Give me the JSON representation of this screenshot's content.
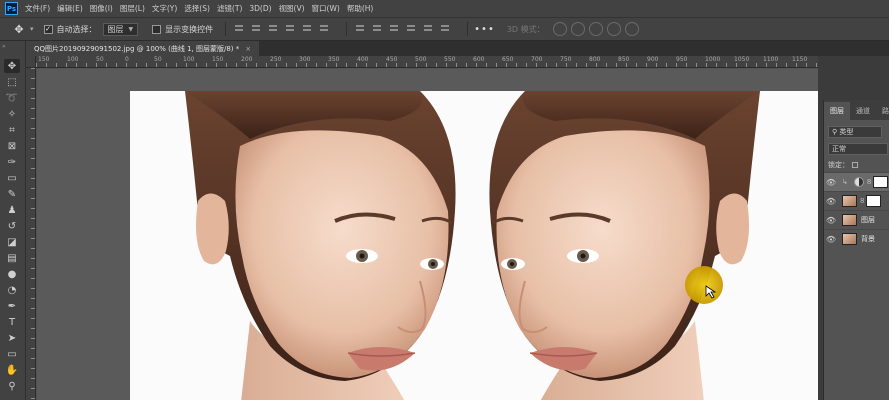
{
  "app": {
    "logo": "Ps"
  },
  "menu": [
    "文件(F)",
    "编辑(E)",
    "图像(I)",
    "图层(L)",
    "文字(Y)",
    "选择(S)",
    "滤镜(T)",
    "3D(D)",
    "视图(V)",
    "窗口(W)",
    "帮助(H)"
  ],
  "options": {
    "auto_select_label": "自动选择：",
    "auto_select_value": "图层",
    "show_transform_label": "显示变换控件",
    "more": "•••",
    "mode_3d": "3D 模式："
  },
  "document": {
    "tab_title": "QQ图片20190929091502.jpg @ 100% (曲线 1, 图层蒙版/8) *",
    "close": "×"
  },
  "ruler": {
    "top_labels": [
      "150",
      "100",
      "50",
      "0",
      "50",
      "100",
      "150",
      "200",
      "250",
      "300",
      "350",
      "400",
      "450",
      "500",
      "550",
      "600",
      "650",
      "700",
      "750",
      "800",
      "850",
      "900",
      "950",
      "1000",
      "1050",
      "1100",
      "1150"
    ]
  },
  "layers_panel": {
    "tabs": [
      "图层",
      "通道",
      "路"
    ],
    "filter_label": "类型",
    "blend_mode": "正常",
    "lock_label": "锁定：",
    "layers": [
      {
        "name": "",
        "kind": "adjustment"
      },
      {
        "name": "",
        "kind": "masked"
      },
      {
        "name": "图层",
        "kind": "pixel"
      },
      {
        "name": "背景",
        "kind": "background"
      }
    ]
  },
  "colors": {
    "cursor_highlight": "#e0b800",
    "panel_bg": "#535353",
    "chrome_bg": "#424242"
  }
}
